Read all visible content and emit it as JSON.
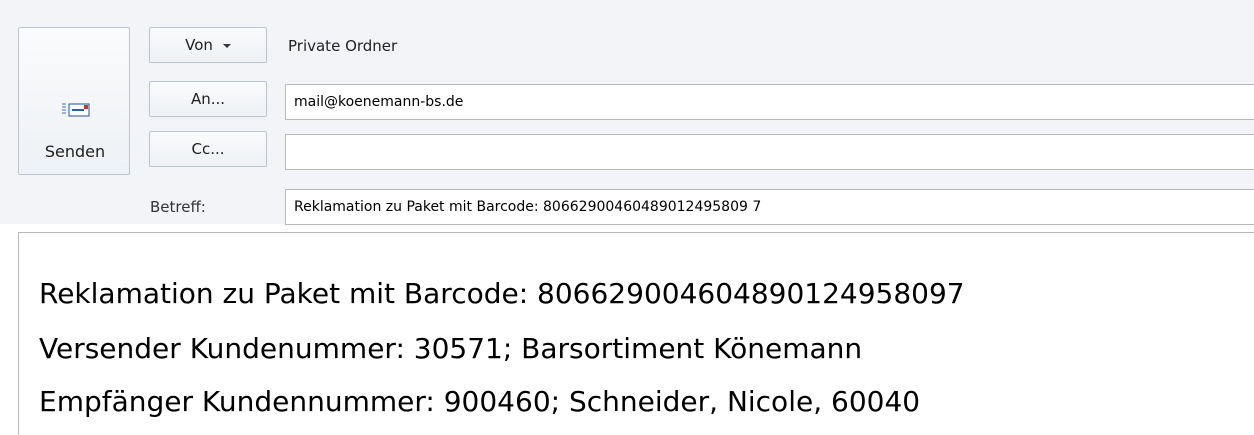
{
  "compose": {
    "send_label": "Senden",
    "from_button": "Von",
    "from_value": "Private Ordner",
    "to_button": "An...",
    "to_value": "mail@koenemann-bs.de",
    "cc_button": "Cc...",
    "cc_value": "",
    "subject_label": "Betreff:",
    "subject_value": "Reklamation zu Paket mit Barcode: 80662900460489012495809 7"
  },
  "body": {
    "lines": [
      "Reklamation zu Paket mit Barcode: 806629004604890124958097",
      "Versender Kundenummer: 30571; Barsortiment Könemann",
      "Empfänger Kundennummer: 900460; Schneider, Nicole, 60040"
    ]
  },
  "icons": {
    "send": "envelope-send-icon",
    "dropdown": "chevron-down-icon"
  }
}
